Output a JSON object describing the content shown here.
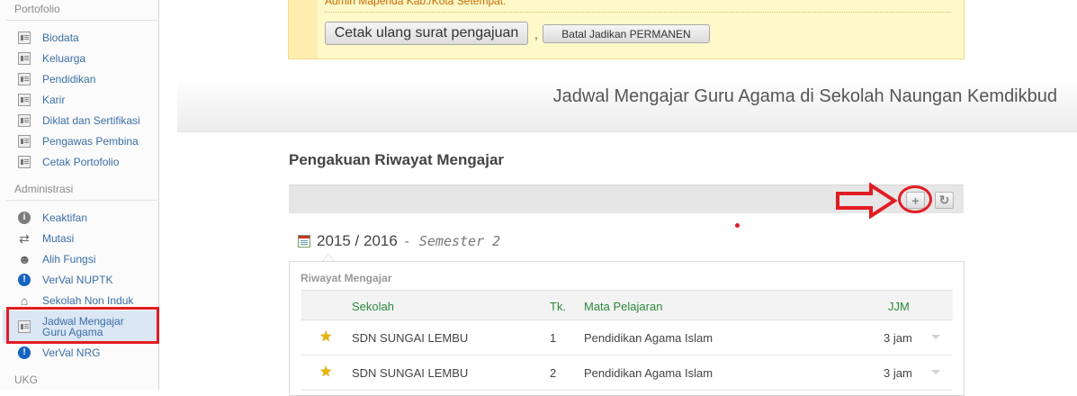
{
  "sidebar": {
    "sections": [
      {
        "title": "Portofolio",
        "items": [
          {
            "label": "Biodata",
            "icon": "document-icon"
          },
          {
            "label": "Keluarga",
            "icon": "document-icon"
          },
          {
            "label": "Pendidikan",
            "icon": "document-icon"
          },
          {
            "label": "Karir",
            "icon": "document-icon"
          },
          {
            "label": "Diklat dan Sertifikasi",
            "icon": "document-icon"
          },
          {
            "label": "Pengawas Pembina",
            "icon": "document-icon"
          },
          {
            "label": "Cetak Portofolio",
            "icon": "document-icon"
          }
        ]
      },
      {
        "title": "Administrasi",
        "items": [
          {
            "label": "Keaktifan",
            "icon": "info-icon"
          },
          {
            "label": "Mutasi",
            "icon": "transfer-icon"
          },
          {
            "label": "Alih Fungsi",
            "icon": "user-icon"
          },
          {
            "label": "VerVal NUPTK",
            "icon": "exclamation-icon"
          },
          {
            "label": "Sekolah Non Induk",
            "icon": "school-icon"
          },
          {
            "label_line1": "Jadwal Mengajar",
            "label_line2": "Guru Agama",
            "icon": "document-icon",
            "active": true
          },
          {
            "label": "VerVal NRG",
            "icon": "exclamation-icon"
          }
        ]
      },
      {
        "title": "UKG"
      }
    ]
  },
  "notice": {
    "text": "Admin Mapenda Kab./Kota Setempat.",
    "btn_cetak": "Cetak ulang surat pengajuan",
    "comma": ",",
    "btn_batal": "Batal Jadikan PERMANEN"
  },
  "page_title": "Jadwal Mengajar Guru Agama di Sekolah Naungan Kemdikbud",
  "section_title": "Pengakuan Riwayat Mengajar",
  "toolbar": {
    "add_icon": "+",
    "refresh_icon": "↻"
  },
  "period": {
    "year": "2015 / 2016",
    "semester": "- Semester 2"
  },
  "panel": {
    "title": "Riwayat Mengajar",
    "columns": {
      "sekolah": "Sekolah",
      "tk": "Tk.",
      "mapel": "Mata Pelajaran",
      "jjm": "JJM"
    },
    "rows": [
      {
        "sekolah": "SDN SUNGAI LEMBU",
        "tk": "1",
        "mapel": "Pendidikan Agama Islam",
        "jjm": "3 jam"
      },
      {
        "sekolah": "SDN SUNGAI LEMBU",
        "tk": "2",
        "mapel": "Pendidikan Agama Islam",
        "jjm": "3 jam"
      }
    ]
  },
  "colors": {
    "annotation_red": "#e21c23",
    "link_blue": "#3b6ea5",
    "header_green": "#2c8a3d",
    "notice_bg": "#fff8c9"
  }
}
